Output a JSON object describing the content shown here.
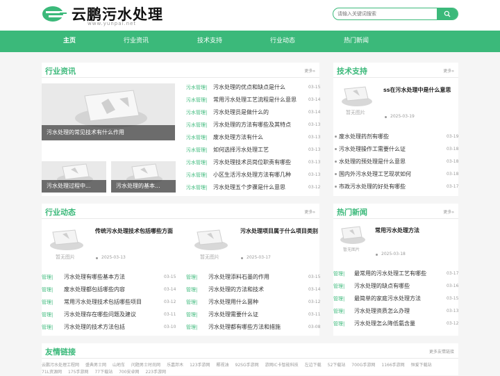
{
  "brand": {
    "name": "云鹏污水处理",
    "url": "www.yunpai.net",
    "color": "#3bb97a"
  },
  "search": {
    "placeholder": "请输入关键词搜索",
    "icon": "search-icon"
  },
  "nav": [
    "主页",
    "行业资讯",
    "技术支持",
    "行业动态",
    "热门新闻"
  ],
  "placeholder_text": "暂无图片",
  "industry_news": {
    "title": "行业资讯",
    "more": "更多»",
    "featured": [
      "污水处理的常见技术有什么作用",
      "污水处理过程中...",
      "污水处理的基本..."
    ],
    "items": [
      {
        "tag": "污水管理|",
        "title": "污水处理的优点和缺点是什么",
        "date": "03-15"
      },
      {
        "tag": "污水管理|",
        "title": "常用污水处理工艺流程是什么意思",
        "date": "03-14"
      },
      {
        "tag": "污水管理|",
        "title": "污水处理员是做什么的",
        "date": "03-14"
      },
      {
        "tag": "污水管理|",
        "title": "污水处理的方法有哪些及其特点",
        "date": "03-13"
      },
      {
        "tag": "污水管理|",
        "title": "废水处理方法有什么",
        "date": "03-13"
      },
      {
        "tag": "污水管理|",
        "title": "如何选择污水处理工艺",
        "date": "03-13"
      },
      {
        "tag": "污水管理|",
        "title": "污水处理技术员岗位职责有哪些",
        "date": "03-13"
      },
      {
        "tag": "污水管理|",
        "title": "小区生活污水处理方法有哪几种",
        "date": "03-13"
      },
      {
        "tag": "污水管理|",
        "title": "污水处理五个步骤是什么意思",
        "date": "03-12"
      }
    ]
  },
  "tech_support": {
    "title": "技术支持",
    "more": "更多»",
    "featured": {
      "title": "ss在污水处理中是什么意思",
      "date": "2025-03-19"
    },
    "items": [
      {
        "title": "废水处理药剂有哪些",
        "date": "03-19"
      },
      {
        "title": "污水处理操作工需要什么证",
        "date": "03-18"
      },
      {
        "title": "水处理的预处理是什么意思",
        "date": "03-18"
      },
      {
        "title": "国内外污水处理工艺现状如何",
        "date": "03-18"
      },
      {
        "title": "市政污水处理的好处有哪些",
        "date": "03-17"
      }
    ]
  },
  "industry_dynamics": {
    "title": "行业动态",
    "more": "更多»",
    "featured": [
      {
        "title": "传统污水处理技术包括哪些方面",
        "date": "2025-03-13"
      },
      {
        "title": "污水处理项目属于什么项目类别",
        "date": "2025-03-17"
      }
    ],
    "left": [
      {
        "tag": "管理|",
        "title": "污水处理有哪些基本方法",
        "date": "03-15"
      },
      {
        "tag": "管理|",
        "title": "废水处理都包括哪些内容",
        "date": "03-14"
      },
      {
        "tag": "管理|",
        "title": "常用污水处理技术包括哪些项目",
        "date": "03-12"
      },
      {
        "tag": "管理|",
        "title": "污水处理存在哪些问题及建议",
        "date": "03-11"
      },
      {
        "tag": "管理|",
        "title": "污水处理的技术方法包括",
        "date": "03-10"
      }
    ],
    "right": [
      {
        "tag": "管理|",
        "title": "污水处理添料石墨的作用",
        "date": "03-15"
      },
      {
        "tag": "管理|",
        "title": "污水处理的方法和技术",
        "date": "03-14"
      },
      {
        "tag": "管理|",
        "title": "污水处理用什么菌种",
        "date": "03-12"
      },
      {
        "tag": "管理|",
        "title": "污水处理需要什么证",
        "date": "03-11"
      },
      {
        "tag": "管理|",
        "title": "污水处理都有哪些方法和措施",
        "date": "03-08"
      }
    ]
  },
  "hot_news": {
    "title": "热门新闻",
    "more": "更多»",
    "featured": {
      "title": "常用污水处理方法",
      "date": "2025-03-18"
    },
    "items": [
      {
        "tag": "管理|",
        "title": "最常用的污水处理工艺有哪些",
        "date": "03-17"
      },
      {
        "tag": "管理|",
        "title": "污水处理的缺点有哪些",
        "date": "03-16"
      },
      {
        "tag": "管理|",
        "title": "最简单的家庭污水处理方法",
        "date": "03-15"
      },
      {
        "tag": "管理|",
        "title": "污水处理资质怎么办理",
        "date": "03-13"
      },
      {
        "tag": "管理|",
        "title": "污水处理怎么降低氨含量",
        "date": "03-12"
      }
    ]
  },
  "friend_links": {
    "title": "友情链接",
    "more": "更多友情链接",
    "items": [
      "云鹏污水处理工程网",
      "盛典男士网",
      "山地车",
      "问题男士时尚网",
      "乐嘉邦木",
      "123手游网",
      "椰视油",
      "92SG手游网",
      "游网IC卡智能科技",
      "左边下载",
      "52下载站",
      "700G手游网",
      "1166手游网",
      "恒爱下载站",
      "71L资源网",
      "175手游网",
      "77下载站",
      "700安卓网",
      "223手游网"
    ]
  }
}
